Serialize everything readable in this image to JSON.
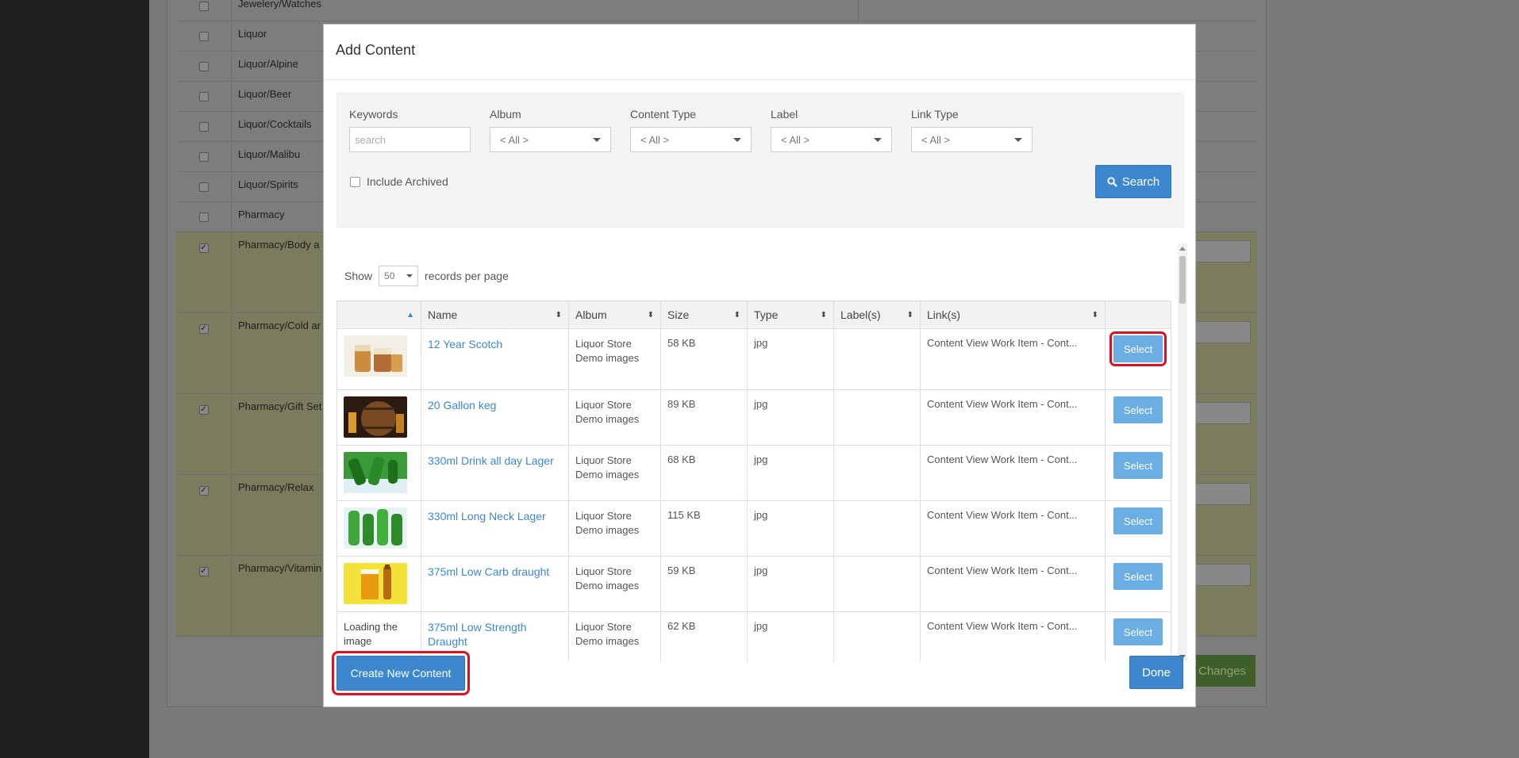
{
  "background": {
    "categories": [
      {
        "label": "Jewelery/Watches",
        "checked": false
      },
      {
        "label": "Liquor",
        "checked": false
      },
      {
        "label": "Liquor/Alpine",
        "checked": false
      },
      {
        "label": "Liquor/Beer",
        "checked": false
      },
      {
        "label": "Liquor/Cocktails",
        "checked": false
      },
      {
        "label": "Liquor/Malibu",
        "checked": false
      },
      {
        "label": "Liquor/Spirits",
        "checked": false
      },
      {
        "label": "Pharmacy",
        "checked": false
      },
      {
        "label": "Pharmacy/Body a",
        "checked": true
      },
      {
        "label": "Pharmacy/Cold ar",
        "checked": true
      },
      {
        "label": "Pharmacy/Gift Set",
        "checked": true
      },
      {
        "label": "Pharmacy/Relax",
        "checked": true
      },
      {
        "label": "Pharmacy/Vitamin",
        "checked": true
      }
    ],
    "save_label": "Changes"
  },
  "modal": {
    "title": "Add Content",
    "filters": {
      "keywords_label": "Keywords",
      "keywords_placeholder": "search",
      "album_label": "Album",
      "album_value": "< All >",
      "content_type_label": "Content Type",
      "content_type_value": "< All >",
      "label_label": "Label",
      "label_value": "< All >",
      "link_type_label": "Link Type",
      "link_type_value": "< All >",
      "include_archived_label": "Include Archived",
      "search_label": "Search"
    },
    "paging": {
      "show_label": "Show",
      "per_page_value": "50",
      "suffix_label": "records per page"
    },
    "columns": [
      "",
      "Name",
      "Album",
      "Size",
      "Type",
      "Label(s)",
      "Link(s)",
      ""
    ],
    "rows": [
      {
        "thumb": "scotch",
        "name": "12 Year Scotch",
        "album": "Liquor Store Demo images",
        "size": "58 KB",
        "type": "jpg",
        "labels": "",
        "links": "Content View Work Item - Cont...",
        "action": "Select"
      },
      {
        "thumb": "keg",
        "name": "20 Gallon keg",
        "album": "Liquor Store Demo images",
        "size": "89 KB",
        "type": "jpg",
        "labels": "",
        "links": "Content View Work Item - Cont...",
        "action": "Select"
      },
      {
        "thumb": "lager-ice",
        "name": "330ml Drink all day Lager",
        "album": "Liquor Store Demo images",
        "size": "68 KB",
        "type": "jpg",
        "labels": "",
        "links": "Content View Work Item - Cont...",
        "action": "Select"
      },
      {
        "thumb": "bottles-ice",
        "name": "330ml Long Neck Lager",
        "album": "Liquor Store Demo images",
        "size": "115 KB",
        "type": "jpg",
        "labels": "",
        "links": "Content View Work Item - Cont...",
        "action": "Select"
      },
      {
        "thumb": "beer-glass",
        "name": "375ml Low Carb draught",
        "album": "Liquor Store Demo images",
        "size": "59 KB",
        "type": "jpg",
        "labels": "",
        "links": "Content View Work Item - Cont...",
        "action": "Select"
      },
      {
        "thumb_text": "Loading the image",
        "name": "375ml Low Strength Draught",
        "album": "Liquor Store Demo images",
        "size": "62 KB",
        "type": "jpg",
        "labels": "",
        "links": "Content View Work Item - Cont...",
        "action": "Select"
      }
    ],
    "create_label": "Create New Content",
    "done_label": "Done"
  },
  "colors": {
    "primary": "#3d87cf",
    "select_button": "#6aaee3",
    "highlight": "#e1101e"
  }
}
